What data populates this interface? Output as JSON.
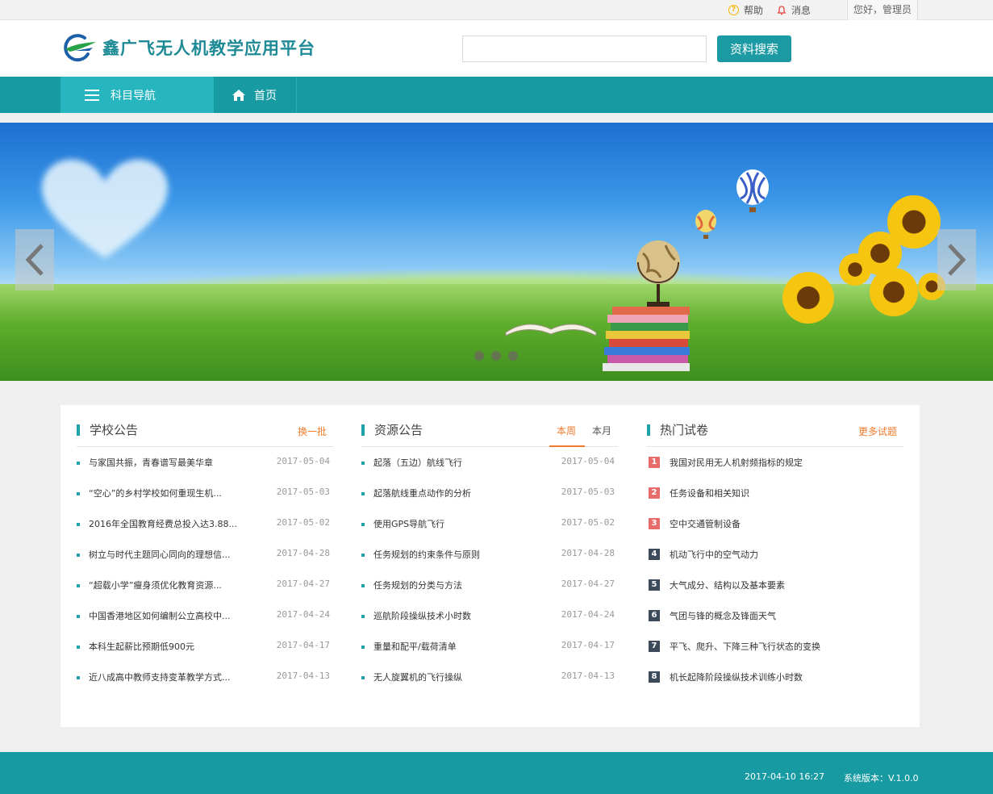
{
  "topbar": {
    "help_label": "帮助",
    "message_label": "消息",
    "user_greeting": "您好，管理员"
  },
  "header": {
    "site_title": "鑫广飞无人机教学应用平台",
    "search_placeholder": "",
    "search_button": "资料搜索"
  },
  "nav": {
    "subject_nav": "科目导航",
    "home": "首页"
  },
  "banner": {
    "slide_count": 3,
    "active_slide": 1
  },
  "school_notice": {
    "title": "学校公告",
    "more": "换一批",
    "items": [
      {
        "text": "与家国共振，青春谱写最美华章",
        "date": "2017-05-04"
      },
      {
        "text": "“空心”的乡村学校如何重现生机...",
        "date": "2017-05-03"
      },
      {
        "text": "2016年全国教育经费总投入达3.88...",
        "date": "2017-05-02"
      },
      {
        "text": "树立与时代主题同心同向的理想信...",
        "date": "2017-04-28"
      },
      {
        "text": "“超载小学”瘦身须优化教育资源...",
        "date": "2017-04-27"
      },
      {
        "text": "中国香港地区如何编制公立高校中...",
        "date": "2017-04-24"
      },
      {
        "text": "本科生起薪比预期低900元",
        "date": "2017-04-17"
      },
      {
        "text": "近八成高中教师支持变革教学方式...",
        "date": "2017-04-13"
      }
    ]
  },
  "resource_notice": {
    "title": "资源公告",
    "tab_week": "本周",
    "tab_month": "本月",
    "items": [
      {
        "text": "起落（五边）航线飞行",
        "date": "2017-05-04"
      },
      {
        "text": "起落航线重点动作的分析",
        "date": "2017-05-03"
      },
      {
        "text": "使用GPS导航飞行",
        "date": "2017-05-02"
      },
      {
        "text": "任务规划的约束条件与原则",
        "date": "2017-04-28"
      },
      {
        "text": "任务规划的分类与方法",
        "date": "2017-04-27"
      },
      {
        "text": "巡航阶段操纵技术小时数",
        "date": "2017-04-24"
      },
      {
        "text": "重量和配平/载荷清单",
        "date": "2017-04-17"
      },
      {
        "text": "无人旋翼机的飞行操纵",
        "date": "2017-04-13"
      }
    ]
  },
  "hot_exams": {
    "title": "热门试卷",
    "more": "更多试题",
    "items": [
      {
        "rank": "1",
        "text": "我国对民用无人机射频指标的规定"
      },
      {
        "rank": "2",
        "text": "任务设备和相关知识"
      },
      {
        "rank": "3",
        "text": "空中交通管制设备"
      },
      {
        "rank": "4",
        "text": "机动飞行中的空气动力"
      },
      {
        "rank": "5",
        "text": "大气成分、结构以及基本要素"
      },
      {
        "rank": "6",
        "text": "气团与锋的概念及锋面天气"
      },
      {
        "rank": "7",
        "text": "平飞、爬升、下降三种飞行状态的变换"
      },
      {
        "rank": "8",
        "text": "机长起降阶段操纵技术训练小时数"
      }
    ]
  },
  "footer": {
    "datetime": "2017-04-10  16:27",
    "version": "系统版本：V.1.0.0"
  },
  "colors": {
    "brand_teal": "#189aa3",
    "nav_active": "#27b5bf",
    "accent_orange": "#f07b2c",
    "rank_hot": "#e86b6b",
    "rank_cold": "#3c4a5c"
  }
}
